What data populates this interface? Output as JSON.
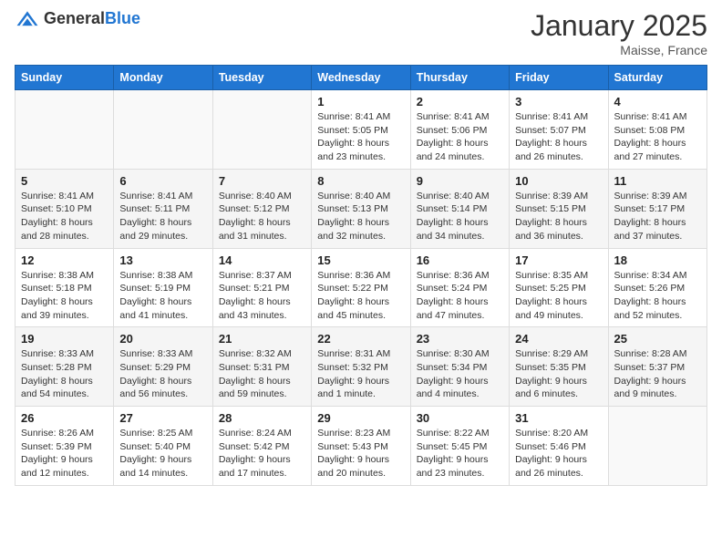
{
  "header": {
    "logo_general": "General",
    "logo_blue": "Blue",
    "month_title": "January 2025",
    "location": "Maisse, France"
  },
  "days_of_week": [
    "Sunday",
    "Monday",
    "Tuesday",
    "Wednesday",
    "Thursday",
    "Friday",
    "Saturday"
  ],
  "weeks": [
    [
      {
        "day": "",
        "sunrise": "",
        "sunset": "",
        "daylight": ""
      },
      {
        "day": "",
        "sunrise": "",
        "sunset": "",
        "daylight": ""
      },
      {
        "day": "",
        "sunrise": "",
        "sunset": "",
        "daylight": ""
      },
      {
        "day": "1",
        "sunrise": "Sunrise: 8:41 AM",
        "sunset": "Sunset: 5:05 PM",
        "daylight": "Daylight: 8 hours and 23 minutes."
      },
      {
        "day": "2",
        "sunrise": "Sunrise: 8:41 AM",
        "sunset": "Sunset: 5:06 PM",
        "daylight": "Daylight: 8 hours and 24 minutes."
      },
      {
        "day": "3",
        "sunrise": "Sunrise: 8:41 AM",
        "sunset": "Sunset: 5:07 PM",
        "daylight": "Daylight: 8 hours and 26 minutes."
      },
      {
        "day": "4",
        "sunrise": "Sunrise: 8:41 AM",
        "sunset": "Sunset: 5:08 PM",
        "daylight": "Daylight: 8 hours and 27 minutes."
      }
    ],
    [
      {
        "day": "5",
        "sunrise": "Sunrise: 8:41 AM",
        "sunset": "Sunset: 5:10 PM",
        "daylight": "Daylight: 8 hours and 28 minutes."
      },
      {
        "day": "6",
        "sunrise": "Sunrise: 8:41 AM",
        "sunset": "Sunset: 5:11 PM",
        "daylight": "Daylight: 8 hours and 29 minutes."
      },
      {
        "day": "7",
        "sunrise": "Sunrise: 8:40 AM",
        "sunset": "Sunset: 5:12 PM",
        "daylight": "Daylight: 8 hours and 31 minutes."
      },
      {
        "day": "8",
        "sunrise": "Sunrise: 8:40 AM",
        "sunset": "Sunset: 5:13 PM",
        "daylight": "Daylight: 8 hours and 32 minutes."
      },
      {
        "day": "9",
        "sunrise": "Sunrise: 8:40 AM",
        "sunset": "Sunset: 5:14 PM",
        "daylight": "Daylight: 8 hours and 34 minutes."
      },
      {
        "day": "10",
        "sunrise": "Sunrise: 8:39 AM",
        "sunset": "Sunset: 5:15 PM",
        "daylight": "Daylight: 8 hours and 36 minutes."
      },
      {
        "day": "11",
        "sunrise": "Sunrise: 8:39 AM",
        "sunset": "Sunset: 5:17 PM",
        "daylight": "Daylight: 8 hours and 37 minutes."
      }
    ],
    [
      {
        "day": "12",
        "sunrise": "Sunrise: 8:38 AM",
        "sunset": "Sunset: 5:18 PM",
        "daylight": "Daylight: 8 hours and 39 minutes."
      },
      {
        "day": "13",
        "sunrise": "Sunrise: 8:38 AM",
        "sunset": "Sunset: 5:19 PM",
        "daylight": "Daylight: 8 hours and 41 minutes."
      },
      {
        "day": "14",
        "sunrise": "Sunrise: 8:37 AM",
        "sunset": "Sunset: 5:21 PM",
        "daylight": "Daylight: 8 hours and 43 minutes."
      },
      {
        "day": "15",
        "sunrise": "Sunrise: 8:36 AM",
        "sunset": "Sunset: 5:22 PM",
        "daylight": "Daylight: 8 hours and 45 minutes."
      },
      {
        "day": "16",
        "sunrise": "Sunrise: 8:36 AM",
        "sunset": "Sunset: 5:24 PM",
        "daylight": "Daylight: 8 hours and 47 minutes."
      },
      {
        "day": "17",
        "sunrise": "Sunrise: 8:35 AM",
        "sunset": "Sunset: 5:25 PM",
        "daylight": "Daylight: 8 hours and 49 minutes."
      },
      {
        "day": "18",
        "sunrise": "Sunrise: 8:34 AM",
        "sunset": "Sunset: 5:26 PM",
        "daylight": "Daylight: 8 hours and 52 minutes."
      }
    ],
    [
      {
        "day": "19",
        "sunrise": "Sunrise: 8:33 AM",
        "sunset": "Sunset: 5:28 PM",
        "daylight": "Daylight: 8 hours and 54 minutes."
      },
      {
        "day": "20",
        "sunrise": "Sunrise: 8:33 AM",
        "sunset": "Sunset: 5:29 PM",
        "daylight": "Daylight: 8 hours and 56 minutes."
      },
      {
        "day": "21",
        "sunrise": "Sunrise: 8:32 AM",
        "sunset": "Sunset: 5:31 PM",
        "daylight": "Daylight: 8 hours and 59 minutes."
      },
      {
        "day": "22",
        "sunrise": "Sunrise: 8:31 AM",
        "sunset": "Sunset: 5:32 PM",
        "daylight": "Daylight: 9 hours and 1 minute."
      },
      {
        "day": "23",
        "sunrise": "Sunrise: 8:30 AM",
        "sunset": "Sunset: 5:34 PM",
        "daylight": "Daylight: 9 hours and 4 minutes."
      },
      {
        "day": "24",
        "sunrise": "Sunrise: 8:29 AM",
        "sunset": "Sunset: 5:35 PM",
        "daylight": "Daylight: 9 hours and 6 minutes."
      },
      {
        "day": "25",
        "sunrise": "Sunrise: 8:28 AM",
        "sunset": "Sunset: 5:37 PM",
        "daylight": "Daylight: 9 hours and 9 minutes."
      }
    ],
    [
      {
        "day": "26",
        "sunrise": "Sunrise: 8:26 AM",
        "sunset": "Sunset: 5:39 PM",
        "daylight": "Daylight: 9 hours and 12 minutes."
      },
      {
        "day": "27",
        "sunrise": "Sunrise: 8:25 AM",
        "sunset": "Sunset: 5:40 PM",
        "daylight": "Daylight: 9 hours and 14 minutes."
      },
      {
        "day": "28",
        "sunrise": "Sunrise: 8:24 AM",
        "sunset": "Sunset: 5:42 PM",
        "daylight": "Daylight: 9 hours and 17 minutes."
      },
      {
        "day": "29",
        "sunrise": "Sunrise: 8:23 AM",
        "sunset": "Sunset: 5:43 PM",
        "daylight": "Daylight: 9 hours and 20 minutes."
      },
      {
        "day": "30",
        "sunrise": "Sunrise: 8:22 AM",
        "sunset": "Sunset: 5:45 PM",
        "daylight": "Daylight: 9 hours and 23 minutes."
      },
      {
        "day": "31",
        "sunrise": "Sunrise: 8:20 AM",
        "sunset": "Sunset: 5:46 PM",
        "daylight": "Daylight: 9 hours and 26 minutes."
      },
      {
        "day": "",
        "sunrise": "",
        "sunset": "",
        "daylight": ""
      }
    ]
  ]
}
